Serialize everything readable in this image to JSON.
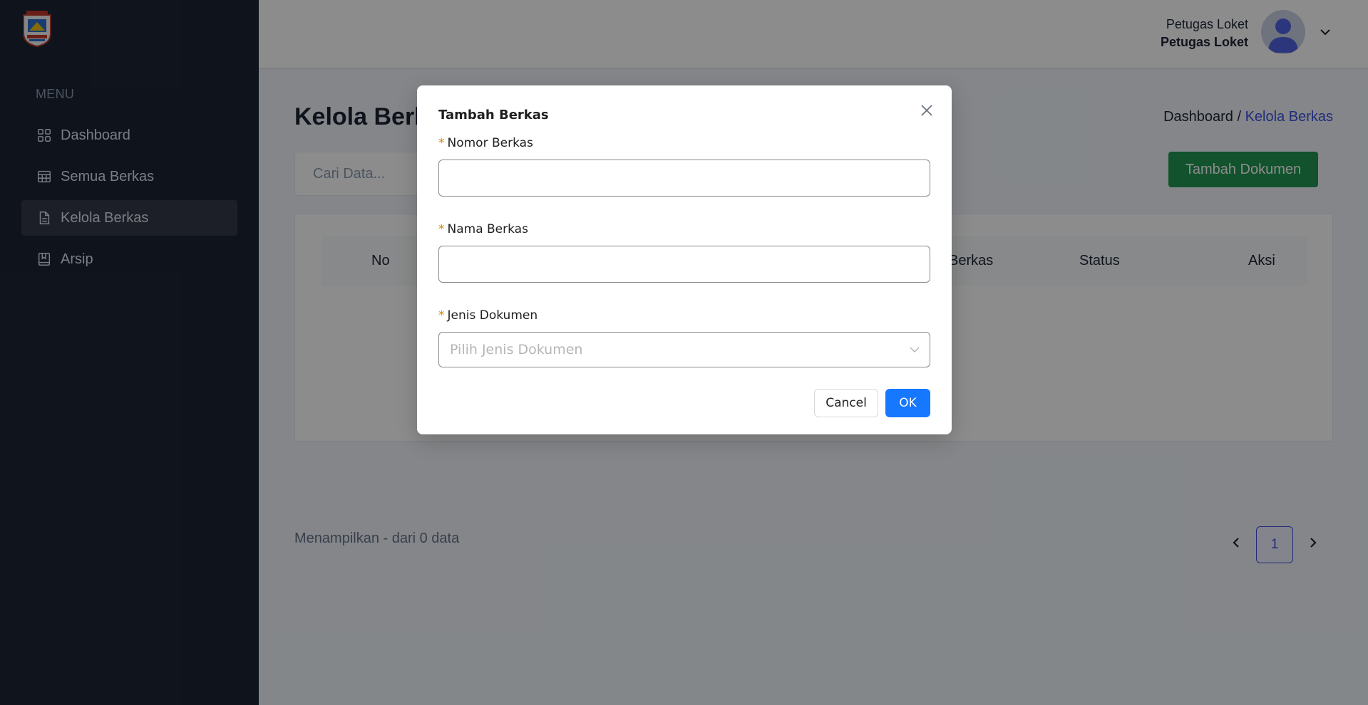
{
  "sidebar": {
    "menu_title": "MENU",
    "items": [
      {
        "label": "Dashboard",
        "icon": "grid-icon"
      },
      {
        "label": "Semua Berkas",
        "icon": "table-icon"
      },
      {
        "label": "Kelola Berkas",
        "icon": "file-icon",
        "active": true
      },
      {
        "label": "Arsip",
        "icon": "book-icon"
      }
    ]
  },
  "header": {
    "user_name": "Petugas Loket",
    "user_role": "Petugas Loket"
  },
  "main": {
    "page_title": "Kelola Berkas",
    "breadcrumb": {
      "home": "Dashboard /",
      "current": "Kelola Berkas"
    },
    "search_placeholder": "Cari Data...",
    "add_button": "Tambah Dokumen",
    "table_headers": [
      "No",
      "Berkas",
      "Status",
      "Aksi"
    ],
    "showing_text": "Menampilkan - dari 0 data",
    "current_page": "1"
  },
  "modal": {
    "title": "Tambah Berkas",
    "required_mark": "*",
    "fields": {
      "nomor_label": "Nomor Berkas",
      "nama_label": "Nama Berkas",
      "jenis_label": "Jenis Dokumen",
      "jenis_placeholder": "Pilih Jenis Dokumen"
    },
    "cancel_label": "Cancel",
    "ok_label": "OK"
  },
  "colors": {
    "sidebar_bg": "#1c2434",
    "primary_button": "#1677ff",
    "success_button": "#219653",
    "link_blue": "#3c50e0"
  }
}
